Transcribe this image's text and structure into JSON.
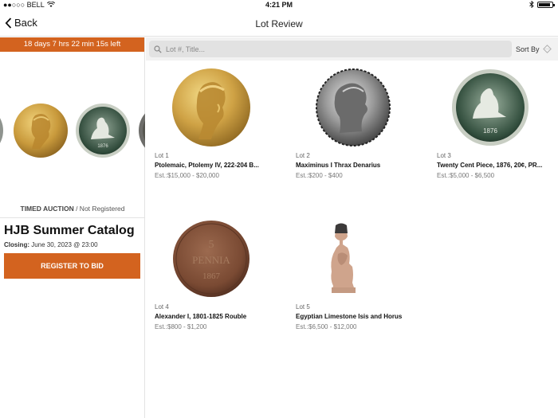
{
  "status_bar": {
    "carrier": "●●○○○ BELL",
    "time": "4:21 PM",
    "bluetooth": "bluetooth-icon",
    "battery_level": 0.9
  },
  "nav": {
    "back_label": "Back",
    "title": "Lot Review"
  },
  "auction": {
    "countdown": "18 days 7 hrs 22 min 15s left",
    "type_label": "TIMED AUCTION",
    "status_label": " / Not Registered",
    "catalog_title": "HJB Summer Catalog",
    "closing_label": "Closing:",
    "closing_value": " June 30, 2023 @ 23:00",
    "register_label": "REGISTER TO BID"
  },
  "search": {
    "placeholder": "Lot #, Title..."
  },
  "sort": {
    "label": "Sort By"
  },
  "colors": {
    "accent": "#d3631f"
  },
  "lots": [
    {
      "number": "Lot 1",
      "title": "Ptolemaic, Ptolemy IV, 222-204 B...",
      "estimate": "Est.:$15,000 - $20,000"
    },
    {
      "number": "Lot 2",
      "title": "Maximinus I Thrax Denarius",
      "estimate": "Est.:$200 - $400"
    },
    {
      "number": "Lot 3",
      "title": "Twenty Cent Piece, 1876, 20¢, PR...",
      "estimate": "Est.:$5,000 - $6,500"
    },
    {
      "number": "Lot 4",
      "title": "Alexander I, 1801-1825 Rouble",
      "estimate": "Est.:$800 - $1,200"
    },
    {
      "number": "Lot 5",
      "title": "Egyptian Limestone Isis and Horus",
      "estimate": "Est.:$6,500 - $12,000"
    }
  ],
  "coin_texts": {
    "year_1876": "1876",
    "pennia_value": "5",
    "pennia_word": "PENNIA",
    "pennia_year": "1867"
  }
}
